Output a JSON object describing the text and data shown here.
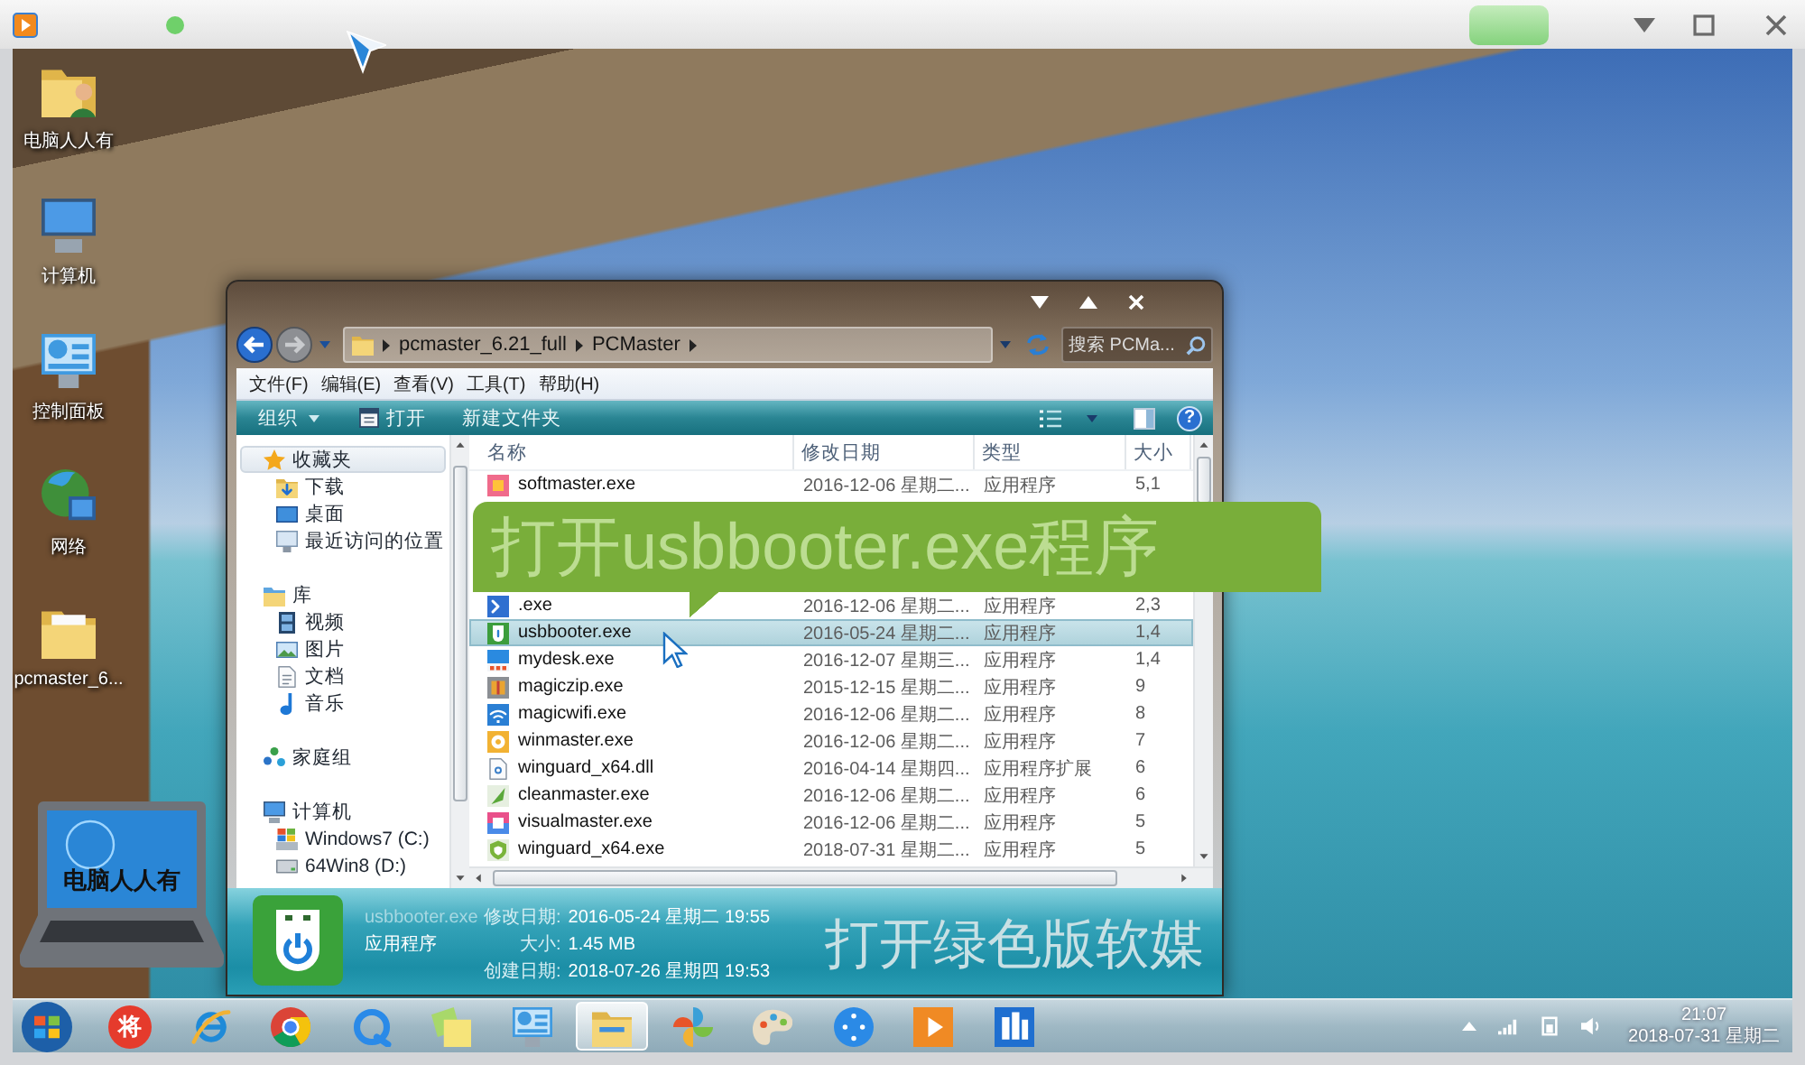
{
  "desktop": {
    "shortcuts": [
      {
        "label": "电脑人人有",
        "kind": "userfolder"
      },
      {
        "label": "计算机",
        "kind": "computer"
      },
      {
        "label": "控制面板",
        "kind": "controlpanel"
      },
      {
        "label": "网络",
        "kind": "network"
      },
      {
        "label": "pcmaster_6...",
        "kind": "folder"
      }
    ]
  },
  "explorer": {
    "breadcrumb": [
      "pcmaster_6.21_full",
      "PCMaster"
    ],
    "search": {
      "placeholder": "搜索 PCMa..."
    },
    "menu": [
      "文件(F)",
      "编辑(E)",
      "查看(V)",
      "工具(T)",
      "帮助(H)"
    ],
    "toolbar": [
      {
        "label": "组织",
        "kind": "menu"
      },
      {
        "label": "打开",
        "kind": "open"
      },
      {
        "label": "新建文件夹",
        "kind": "plain"
      }
    ],
    "help": "?",
    "nav": [
      {
        "label": "收藏夹",
        "kind": "star",
        "selected": true,
        "children": [
          {
            "label": "下载",
            "kind": "download",
            "selected": false
          },
          {
            "label": "桌面",
            "kind": "desktop",
            "selected": false
          },
          {
            "label": "最近访问的位置",
            "kind": "recent",
            "selected": false
          }
        ]
      },
      {
        "label": "库",
        "kind": "library",
        "selected": false,
        "children": [
          {
            "label": "视频",
            "kind": "video",
            "selected": false
          },
          {
            "label": "图片",
            "kind": "picture",
            "selected": false
          },
          {
            "label": "文档",
            "kind": "document",
            "selected": false
          },
          {
            "label": "音乐",
            "kind": "music",
            "selected": false
          }
        ]
      },
      {
        "label": "家庭组",
        "kind": "homegroup",
        "selected": false
      },
      {
        "label": "计算机",
        "kind": "computer",
        "selected": false,
        "children": [
          {
            "label": "Windows7 (C:)",
            "kind": "drivec",
            "selected": false
          },
          {
            "label": "64Win8  (D:)",
            "kind": "drive",
            "selected": false
          }
        ]
      }
    ],
    "columns": [
      "名称",
      "修改日期",
      "类型",
      "大小"
    ],
    "rows": [
      {
        "name": "softmaster.exe",
        "kind": "soft",
        "date": "2016-12-06 星期二...",
        "type": "应用程序",
        "size": "5,1",
        "selected": false
      },
      {
        "name": ".exe",
        "kind": "shell",
        "date": "2016-12-06 星期二...",
        "type": "应用程序",
        "size": "2,3",
        "selected": false
      },
      {
        "name": "usbbooter.exe",
        "kind": "usb",
        "date": "2016-05-24 星期二...",
        "type": "应用程序",
        "size": "1,4",
        "selected": true
      },
      {
        "name": "mydesk.exe",
        "kind": "desk",
        "date": "2016-12-07 星期三...",
        "type": "应用程序",
        "size": "1,4",
        "selected": false
      },
      {
        "name": "magiczip.exe",
        "kind": "zip",
        "date": "2015-12-15 星期二...",
        "type": "应用程序",
        "size": "9",
        "selected": false
      },
      {
        "name": "magicwifi.exe",
        "kind": "wifi",
        "date": "2016-12-06 星期二...",
        "type": "应用程序",
        "size": "8",
        "selected": false
      },
      {
        "name": "winmaster.exe",
        "kind": "gear",
        "date": "2016-12-06 星期二...",
        "type": "应用程序",
        "size": "7",
        "selected": false
      },
      {
        "name": "winguard_x64.dll",
        "kind": "dll",
        "date": "2016-04-14 星期四...",
        "type": "应用程序扩展",
        "size": "6",
        "selected": false
      },
      {
        "name": "cleanmaster.exe",
        "kind": "broom",
        "date": "2016-12-06 星期二...",
        "type": "应用程序",
        "size": "6",
        "selected": false
      },
      {
        "name": "visualmaster.exe",
        "kind": "visual",
        "date": "2016-12-06 星期二...",
        "type": "应用程序",
        "size": "5",
        "selected": false
      },
      {
        "name": "winguard_x64.exe",
        "kind": "shield",
        "date": "2018-07-31 星期二...",
        "type": "应用程序",
        "size": "5",
        "selected": false
      }
    ],
    "details": {
      "name": "usbbooter.exe",
      "type": "应用程序",
      "fields": [
        {
          "label": "修改日期:",
          "value": "2016-05-24 星期二 19:55"
        },
        {
          "label": "大小:",
          "value": "1.45 MB"
        },
        {
          "label": "创建日期:",
          "value": "2018-07-26 星期四 19:53"
        }
      ]
    }
  },
  "callout": {
    "text": "打开usbbooter.exe程序"
  },
  "caption": "打开绿色版软媒",
  "logo": {
    "text": "电脑人人有"
  },
  "taskbar": {
    "apps": [
      {
        "kind": "start",
        "selected": false
      },
      {
        "kind": "badge",
        "label": "将",
        "selected": false
      },
      {
        "kind": "ie",
        "selected": false
      },
      {
        "kind": "chrome",
        "selected": false
      },
      {
        "kind": "ring",
        "selected": false
      },
      {
        "kind": "notes",
        "selected": false
      },
      {
        "kind": "panel",
        "selected": false
      },
      {
        "kind": "explorer",
        "selected": true
      },
      {
        "kind": "pinwheel",
        "selected": false
      },
      {
        "kind": "paint",
        "selected": false
      },
      {
        "kind": "media",
        "selected": false
      },
      {
        "kind": "player",
        "selected": false
      },
      {
        "kind": "building",
        "selected": false
      }
    ],
    "clock": {
      "time": "21:07",
      "date": "2018-07-31 星期二"
    }
  }
}
